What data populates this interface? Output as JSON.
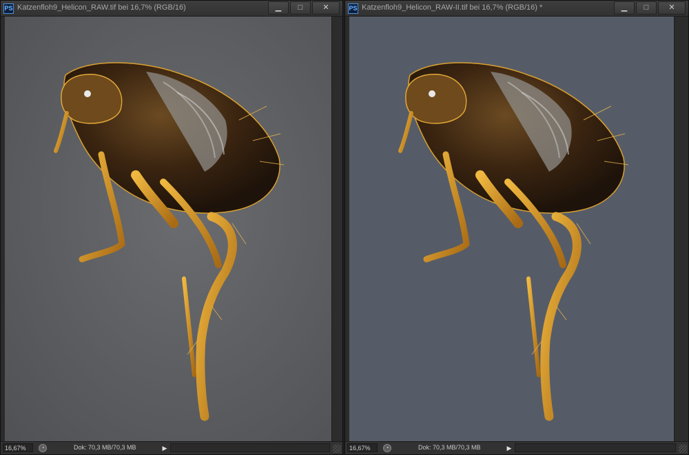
{
  "windows": [
    {
      "app_icon": "PS",
      "title": "Katzenfloh9_Helicon_RAW.tif bei 16,7% (RGB/16)",
      "controls": {
        "minimize": "▁",
        "maximize": "□",
        "close": "✕"
      },
      "zoom": "16,67%",
      "doc_info": "Dok: 70,3 MB/70,3 MB",
      "background_color": "#5f6165"
    },
    {
      "app_icon": "PS",
      "title": "Katzenfloh9_Helicon_RAW-II.tif bei 16,7% (RGB/16) *",
      "controls": {
        "minimize": "▁",
        "maximize": "□",
        "close": "✕"
      },
      "zoom": "16,67%",
      "doc_info": "Dok: 70,3 MB/70,3 MB",
      "background_color": "#565c67"
    }
  ],
  "icons": {
    "app": "photoshop-icon",
    "status": "status-menu-icon",
    "arrow": "triangle-right-icon"
  },
  "colors": {
    "flea_dark": "#3a2410",
    "flea_mid": "#8a5a18",
    "flea_gold": "#d9a030"
  }
}
